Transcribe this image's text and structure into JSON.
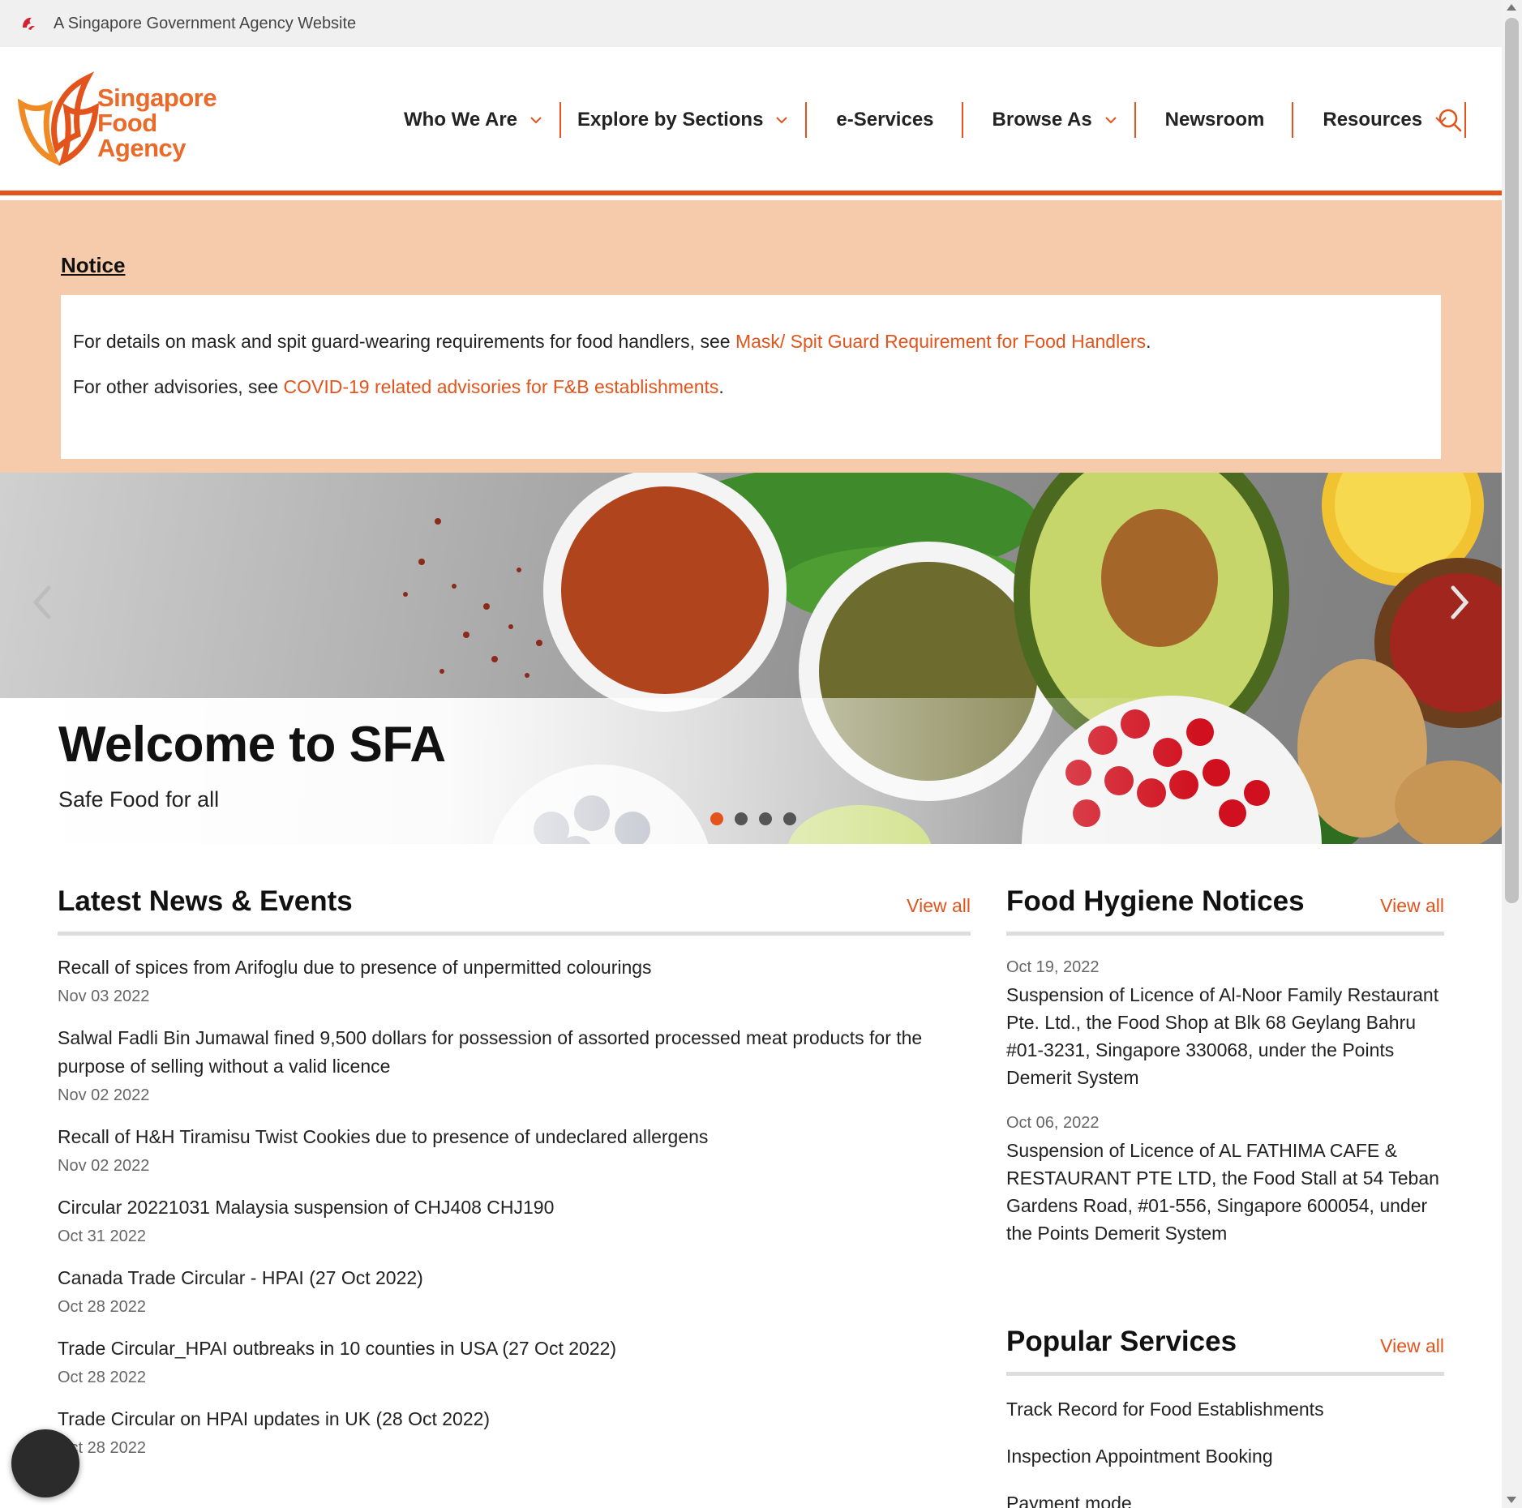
{
  "masthead": {
    "text": "A Singapore Government Agency Website",
    "icon": "lion-head-icon"
  },
  "logo": {
    "line1": "Singapore",
    "line2": "Food",
    "line3": "Agency"
  },
  "nav": [
    {
      "label": "Who We Are",
      "dropdown": true
    },
    {
      "label": "Explore by Sections",
      "dropdown": true
    },
    {
      "label": "e-Services",
      "dropdown": false
    },
    {
      "label": "Browse As",
      "dropdown": true
    },
    {
      "label": "Newsroom",
      "dropdown": false
    },
    {
      "label": "Resources",
      "dropdown": true
    }
  ],
  "notice": {
    "title": "Notice",
    "p1_before": "For details on mask and spit guard-wearing requirements for food handlers, see ",
    "p1_link": "Mask/ Spit Guard Requirement for Food Handlers",
    "p1_after": ".",
    "p2_before": "For other advisories, see ",
    "p2_link": "COVID-19 related advisories for F&B establishments",
    "p2_after": "."
  },
  "hero": {
    "title": "Welcome to SFA",
    "subtitle": "Safe Food for all",
    "slide_count": 4,
    "active_slide": 1
  },
  "news": {
    "title": "Latest News & Events",
    "view_all": "View all",
    "items": [
      {
        "title": "Recall of spices from Arifoglu due to presence of unpermitted colourings",
        "date": "Nov 03 2022"
      },
      {
        "title": "Salwal Fadli Bin Jumawal fined 9,500 dollars for possession of assorted processed meat products for the purpose of selling without a valid licence",
        "date": "Nov 02 2022"
      },
      {
        "title": "Recall of H&H Tiramisu Twist Cookies due to presence of undeclared allergens",
        "date": "Nov 02 2022"
      },
      {
        "title": "Circular 20221031 Malaysia suspension of CHJ408 CHJ190",
        "date": "Oct 31 2022"
      },
      {
        "title": "Canada Trade Circular - HPAI (27 Oct 2022)",
        "date": "Oct 28 2022"
      },
      {
        "title": "Trade Circular_HPAI outbreaks in 10 counties in USA (27 Oct 2022)",
        "date": "Oct 28 2022"
      },
      {
        "title": "Trade Circular on HPAI updates in UK (28 Oct 2022)",
        "date": "Oct 28 2022"
      }
    ]
  },
  "hygiene": {
    "title": "Food Hygiene Notices",
    "view_all": "View all",
    "items": [
      {
        "date": "Oct 19, 2022",
        "title": "Suspension of Licence of Al-Noor Family Restaurant Pte. Ltd., the Food Shop at Blk 68 Geylang Bahru #01-3231, Singapore 330068, under the Points Demerit System"
      },
      {
        "date": "Oct 06, 2022",
        "title": "Suspension of Licence of AL FATHIMA CAFE & RESTAURANT PTE LTD, the Food Stall at 54 Teban Gardens Road, #01-556, Singapore 600054, under the Points Demerit System"
      }
    ]
  },
  "popular": {
    "title": "Popular Services",
    "view_all": "View all",
    "items": [
      "Track Record for Food Establishments",
      "Inspection Appointment Booking",
      "Payment mode"
    ]
  },
  "colors": {
    "brand_orange": "#e2541c",
    "notice_bg": "#f5cbab",
    "masthead_bg": "#f0f0f0"
  }
}
